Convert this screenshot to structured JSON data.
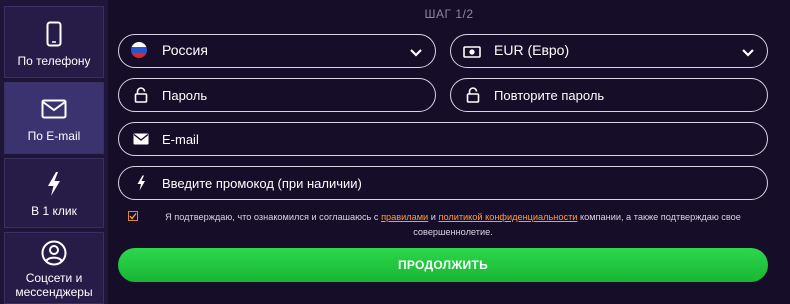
{
  "sidebar": {
    "items": [
      {
        "label": "По телефону",
        "icon": "phone-icon",
        "active": false
      },
      {
        "label": "По E-mail",
        "icon": "envelope-icon",
        "active": true
      },
      {
        "label": "В 1 клик",
        "icon": "lightning-icon",
        "active": false
      },
      {
        "label_line1": "Соцсети и",
        "label_line2": "мессенджеры",
        "icon": "user-circle-icon",
        "active": false
      }
    ]
  },
  "form": {
    "step": "ШАГ 1/2",
    "country": "Россия",
    "currency": "EUR (Евро)",
    "password_placeholder": "Пароль",
    "repeat_password_placeholder": "Повторите пароль",
    "email_placeholder": "E-mail",
    "promo_placeholder": "Введите промокод (при наличии)",
    "agree": {
      "prefix": "Я подтверждаю, что ознакомился и соглашаюсь с",
      "rules_link": "правилами",
      "and": "и",
      "privacy_link": "политикой конфиденциальности",
      "suffix_line1": "компании, а также подтверждаю свое",
      "suffix_line2": "совершеннолетие."
    },
    "submit_label": "ПРОДОЛЖИТЬ"
  },
  "colors": {
    "background": "#1a1132",
    "accent_green": "#22c83e",
    "link_orange": "#ff9b36",
    "active_tab": "#3a3370"
  }
}
